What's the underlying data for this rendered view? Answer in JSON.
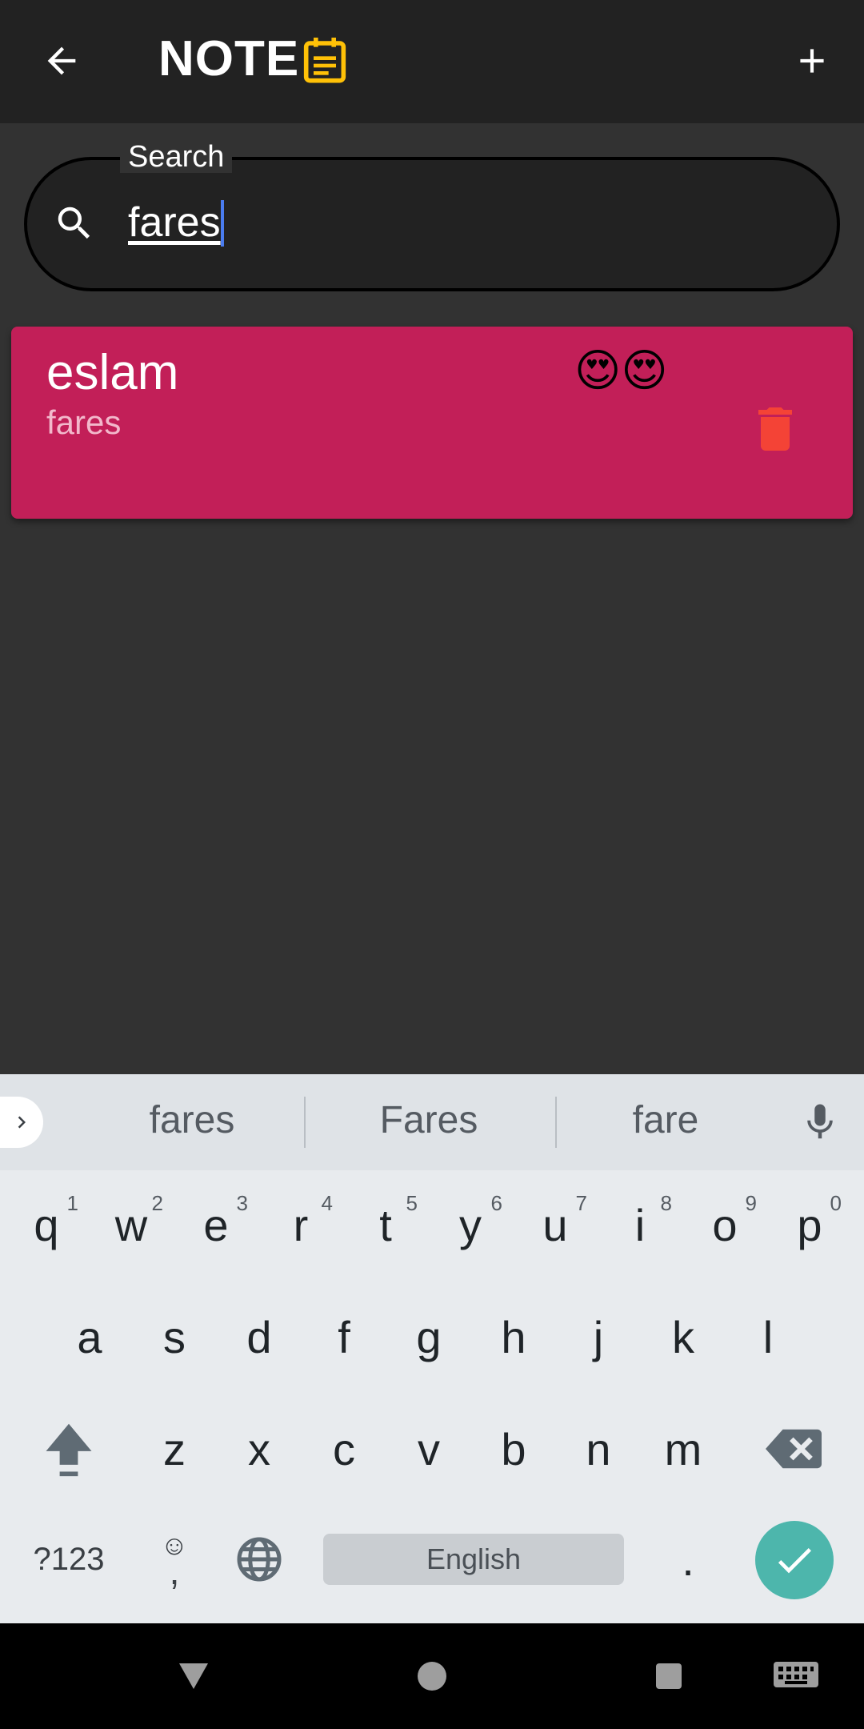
{
  "appbar": {
    "title": "NOTE",
    "back_icon": "arrow-back-icon",
    "title_icon": "note-icon",
    "add_icon": "plus-icon",
    "title_icon_color": "#FFC107"
  },
  "search": {
    "label": "Search",
    "value": "fares",
    "icon": "search-icon"
  },
  "notes": [
    {
      "title": "eslam",
      "body": "fares",
      "emoji": "😍😍",
      "color": "#C21F58",
      "delete_icon": "trash-icon"
    }
  ],
  "keyboard": {
    "suggestions": [
      "fares",
      "Fares",
      "fare"
    ],
    "row1": [
      {
        "key": "q",
        "hint": "1"
      },
      {
        "key": "w",
        "hint": "2"
      },
      {
        "key": "e",
        "hint": "3"
      },
      {
        "key": "r",
        "hint": "4"
      },
      {
        "key": "t",
        "hint": "5"
      },
      {
        "key": "y",
        "hint": "6"
      },
      {
        "key": "u",
        "hint": "7"
      },
      {
        "key": "i",
        "hint": "8"
      },
      {
        "key": "o",
        "hint": "9"
      },
      {
        "key": "p",
        "hint": "0"
      }
    ],
    "row2": [
      "a",
      "s",
      "d",
      "f",
      "g",
      "h",
      "j",
      "k",
      "l"
    ],
    "row3": [
      "z",
      "x",
      "c",
      "v",
      "b",
      "n",
      "m"
    ],
    "symbols_label": "?123",
    "emoji_label": "☺",
    "comma_label": ",",
    "space_label": "English",
    "period_label": ".",
    "enter_color": "#4DB6AC"
  },
  "navbar": {
    "back_icon": "nav-back-icon",
    "home_icon": "nav-home-icon",
    "recents_icon": "nav-recents-icon",
    "keyboard_icon": "keyboard-icon"
  }
}
